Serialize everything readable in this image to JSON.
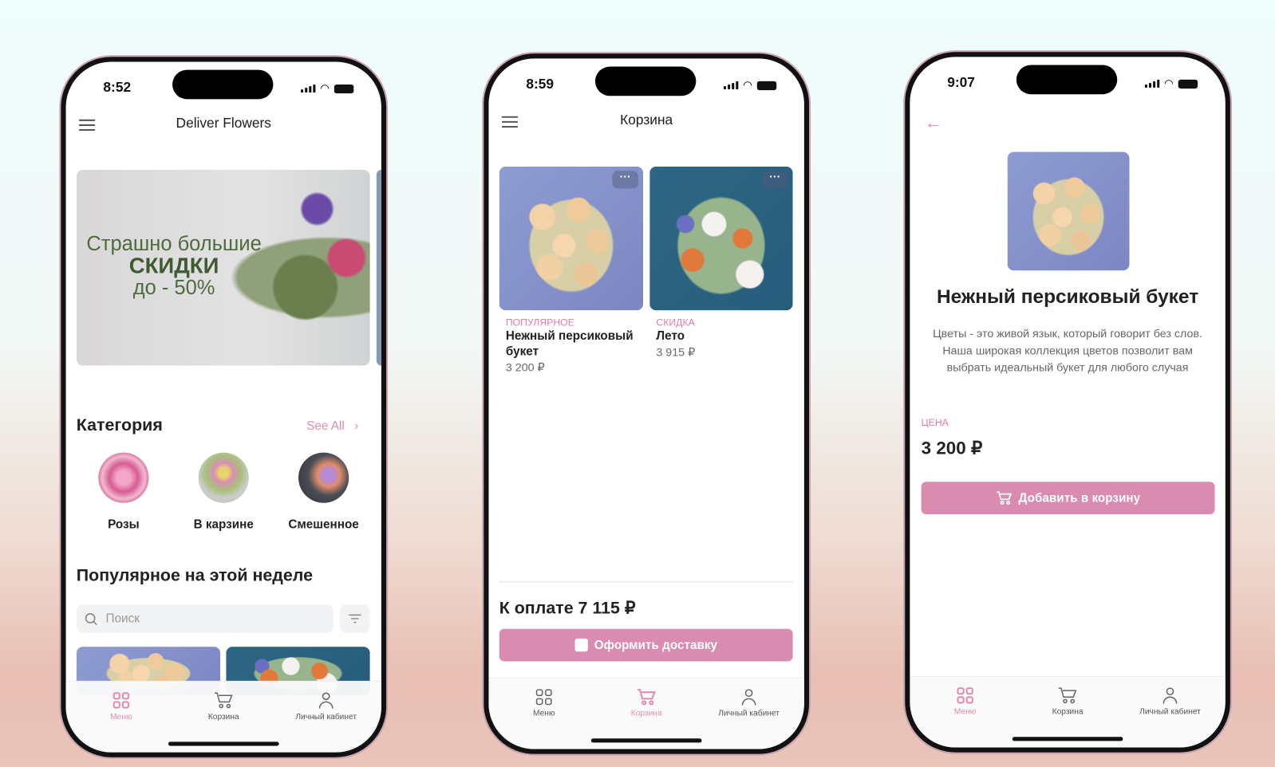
{
  "colors": {
    "accent": "#d98bb0",
    "tag": "#e27ba8"
  },
  "phone1": {
    "time": "8:52",
    "title": "Deliver Flowers",
    "banner": {
      "line1": "Страшно большие",
      "line2": "СКИДКИ",
      "line3": "до - 50%"
    },
    "category_title": "Категория",
    "see_all": "See All",
    "categories": [
      {
        "label": "Розы"
      },
      {
        "label": "В карзине"
      },
      {
        "label": "Смешенное"
      }
    ],
    "popular_title": "Популярное на этой неделе",
    "search_placeholder": "Поиск"
  },
  "phone2": {
    "time": "8:59",
    "title": "Корзина",
    "items": [
      {
        "tag": "Популярное",
        "name": "Нежный персиковый букет",
        "price": "3 200 ₽"
      },
      {
        "tag": "Скидка",
        "name": "Лето",
        "price": "3 915 ₽"
      }
    ],
    "total": "К оплате 7 115 ₽",
    "checkout": "Оформить доставку"
  },
  "phone3": {
    "time": "9:07",
    "title": "Нежный персиковый букет",
    "description": "Цветы - это живой язык, который говорит без слов. Наша широкая коллекция цветов позволит вам выбрать идеальный букет для любого случая",
    "price_label": "Цена",
    "price": "3 200 ₽",
    "add_to_cart": "Добавить в корзину"
  },
  "tabs": {
    "menu": "Меню",
    "cart": "Корзина",
    "profile": "Личный кабинет"
  }
}
